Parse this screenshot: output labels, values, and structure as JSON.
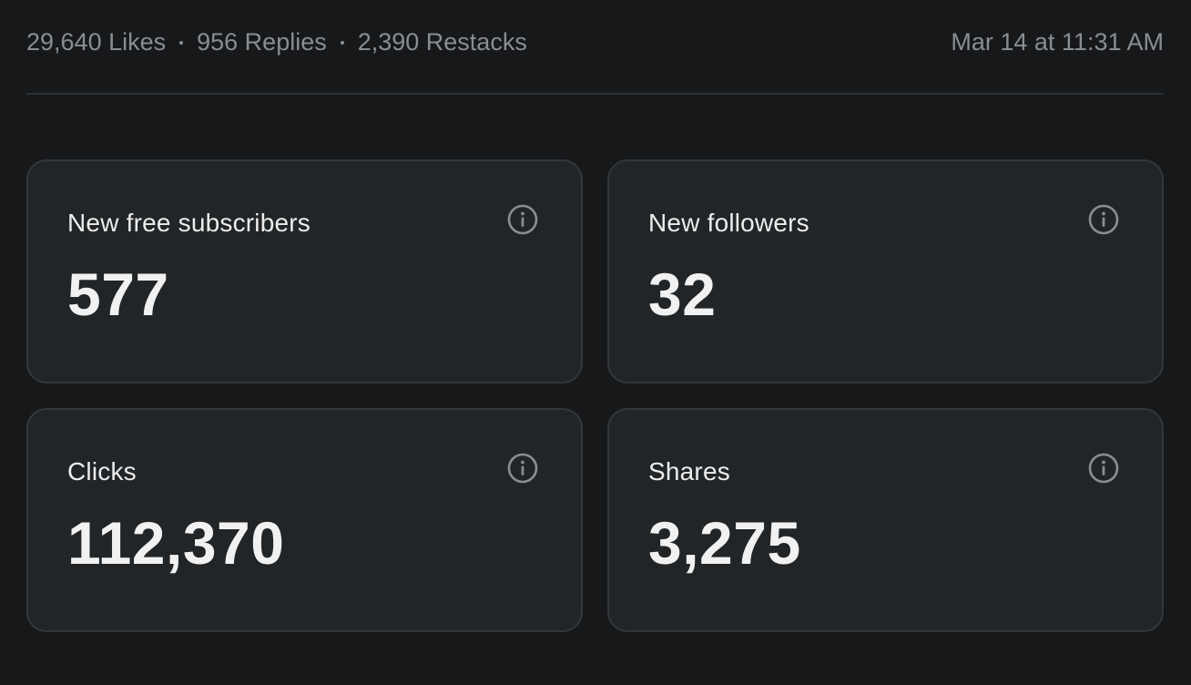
{
  "stats": {
    "likes": "29,640 Likes",
    "replies": "956 Replies",
    "restacks": "2,390 Restacks",
    "timestamp": "Mar 14 at 11:31 AM"
  },
  "cards": [
    {
      "label": "New free subscribers",
      "value": "577",
      "icon": "info-icon"
    },
    {
      "label": "New followers",
      "value": "32",
      "icon": "info-icon"
    },
    {
      "label": "Clicks",
      "value": "112,370",
      "icon": "info-icon"
    },
    {
      "label": "Shares",
      "value": "3,275",
      "icon": "info-icon"
    }
  ],
  "colors": {
    "background": "#16181a",
    "card_background": "#222527",
    "card_border": "#33373a",
    "muted_text": "#8a8d91",
    "primary_text": "#f1f1f1"
  }
}
